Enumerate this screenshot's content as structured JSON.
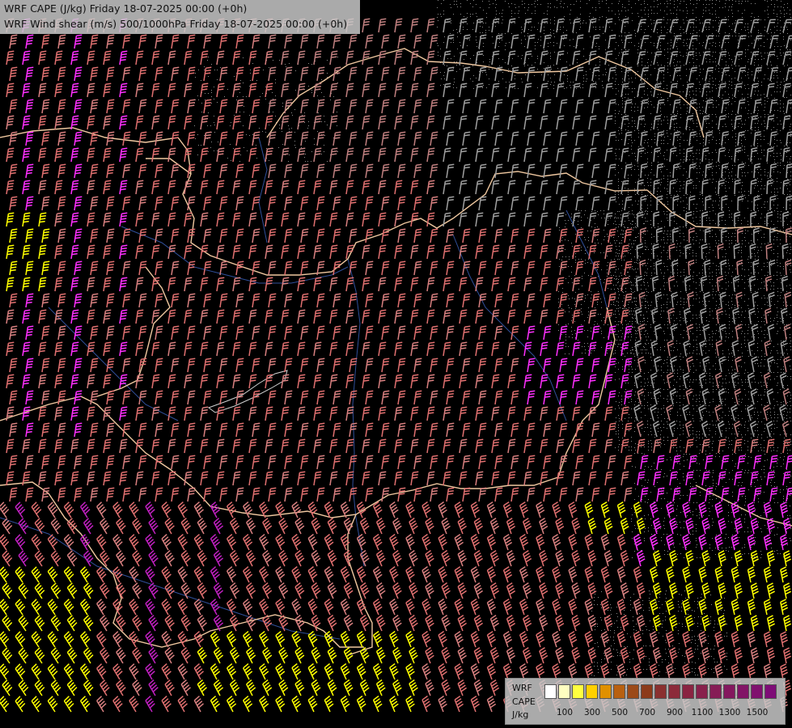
{
  "title": {
    "line1": "WRF CAPE (J/kg) Friday 18-07-2025 00:00 (+0h)",
    "line2": "WRF Wind shear (m/s) 500/1000hPa Friday 18-07-2025 00:00 (+0h)"
  },
  "legend": {
    "label_model": "WRF",
    "label_var": "CAPE",
    "label_unit": "J/kg",
    "colors": [
      "#ffffff",
      "#ffffc0",
      "#ffff40",
      "#ffd000",
      "#e09000",
      "#b86010",
      "#9c4a18",
      "#8c3a1a",
      "#8a3030",
      "#8c2a3a",
      "#8a2442",
      "#88204c",
      "#861c56",
      "#84185e",
      "#821466",
      "#80106e",
      "#7e0c76"
    ],
    "ticks": [
      "100",
      "300",
      "500",
      "700",
      "900",
      "1100",
      "1300",
      "1500"
    ]
  },
  "map_style": {
    "background": "#000000",
    "border_color": "#f0c8a0",
    "river_color": "#3050a0",
    "barb_colors": [
      "#e07070",
      "#d88080",
      "#c08080",
      "#a0a0a0",
      "#ff30ff",
      "#c020c0",
      "#ffff00"
    ]
  }
}
